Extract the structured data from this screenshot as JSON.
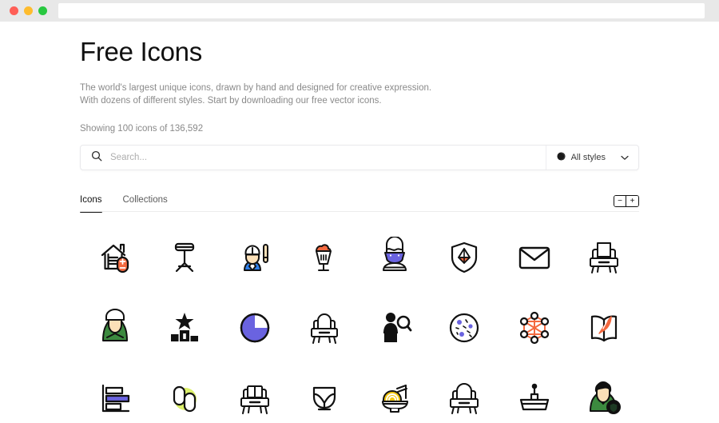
{
  "browser": {
    "traffic_lights": [
      "close",
      "minimize",
      "maximize"
    ],
    "url_value": "",
    "colors": {
      "close": "#ff5f57",
      "minimize": "#febc2e",
      "maximize": "#28c840",
      "chrome_bg": "#e8e8e8"
    }
  },
  "header": {
    "title": "Free Icons",
    "subtitle_line1": "The world's largest unique icons, drawn by hand and designed for creative expression.",
    "subtitle_line2": "With dozens of different styles. Start by downloading our free vector icons.",
    "showing": "Showing 100 icons of 136,592"
  },
  "search": {
    "placeholder": "Search...",
    "value": "",
    "icon": "search-icon",
    "style_filter": {
      "label": "All styles",
      "icon": "half-filled-circle-icon",
      "chevron": "chevron-down-icon"
    }
  },
  "tabs": [
    {
      "label": "Icons",
      "active": true
    },
    {
      "label": "Collections",
      "active": false
    }
  ],
  "zoom_controls": {
    "decrease_label": "−",
    "increase_label": "+"
  },
  "theme": {
    "accent_orange": "#f4693f",
    "accent_purple": "#6a63e0",
    "accent_blue": "#2f7fe8",
    "accent_green": "#3c8a3f",
    "accent_lime": "#dcf06a",
    "accent_yellow": "#f2c60f",
    "ink": "#111111",
    "muted_text": "#8a8a8a",
    "skin": "#fbe0b8"
  },
  "icons": [
    {
      "name": "house-energy-meter-icon",
      "label": "House with plus minus meter"
    },
    {
      "name": "drum-stool-icon",
      "label": "Drum stool"
    },
    {
      "name": "baseball-player-icon",
      "label": "Baseball player with bat"
    },
    {
      "name": "milkshake-icon",
      "label": "Milkshake glass"
    },
    {
      "name": "person-face-mask-icon",
      "label": "Person wearing mask"
    },
    {
      "name": "shield-diamond-icon",
      "label": "Shield with diamond"
    },
    {
      "name": "envelope-icon",
      "label": "Envelope"
    },
    {
      "name": "armchair-icon",
      "label": "Armchair"
    },
    {
      "name": "soldier-avatar-icon",
      "label": "Soldier avatar"
    },
    {
      "name": "podium-star-icon",
      "label": "Winner podium with star"
    },
    {
      "name": "pie-chart-icon",
      "label": "Pie chart"
    },
    {
      "name": "bench-seat-icon",
      "label": "Bench seat"
    },
    {
      "name": "person-search-icon",
      "label": "Person with magnifier"
    },
    {
      "name": "petri-dish-icon",
      "label": "Petri dish bacteria"
    },
    {
      "name": "network-nodes-icon",
      "label": "Network nodes hexagon"
    },
    {
      "name": "book-quill-icon",
      "label": "Open book with quill"
    },
    {
      "name": "bar-chart-horizontal-icon",
      "label": "Horizontal bar chart"
    },
    {
      "name": "capsule-pills-icon",
      "label": "Two capsules"
    },
    {
      "name": "sofa-chair-icon",
      "label": "Sofa chair"
    },
    {
      "name": "whale-tail-icon",
      "label": "Whale tail bowl"
    },
    {
      "name": "noodles-bowl-icon",
      "label": "Noodles bowl with chopsticks"
    },
    {
      "name": "armchair-alt-icon",
      "label": "Armchair alternate"
    },
    {
      "name": "sink-basin-icon",
      "label": "Sink basin"
    },
    {
      "name": "user-shield-icon",
      "label": "User with shield badge"
    }
  ]
}
